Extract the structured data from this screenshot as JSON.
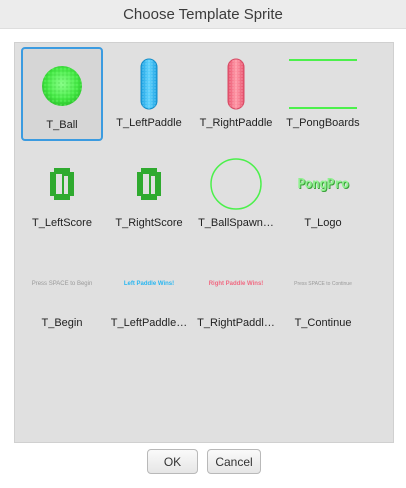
{
  "dialog": {
    "title": "Choose Template Sprite"
  },
  "sprites": [
    {
      "label": "T_Ball",
      "icon": "ball-icon",
      "selected": true
    },
    {
      "label": "T_LeftPaddle",
      "icon": "blue-paddle-icon"
    },
    {
      "label": "T_RightPaddle",
      "icon": "red-paddle-icon"
    },
    {
      "label": "T_PongBoards",
      "icon": "boards-icon"
    },
    {
      "label": "T_LeftScore",
      "icon": "score-digit-icon",
      "digit": "0"
    },
    {
      "label": "T_RightScore",
      "icon": "score-digit-icon",
      "digit": "0"
    },
    {
      "label": "T_BallSpawn…",
      "icon": "spawn-circle-icon"
    },
    {
      "label": "T_Logo",
      "icon": "logo-icon",
      "text": "PongPro"
    },
    {
      "label": "T_Begin",
      "icon": "begin-text-icon",
      "text": "Press SPACE to Begin"
    },
    {
      "label": "T_LeftPaddle…",
      "icon": "left-win-text-icon",
      "text": "Left Paddle Wins!"
    },
    {
      "label": "T_RightPaddl…",
      "icon": "right-win-text-icon",
      "text": "Right Paddle Wins!"
    },
    {
      "label": "T_Continue",
      "icon": "continue-text-icon",
      "text": "Press SPACE to Continue"
    }
  ],
  "buttons": {
    "ok": "OK",
    "cancel": "Cancel"
  },
  "colors": {
    "accent": "#3b9be0",
    "ball_green": "#4cf04c",
    "paddle_blue": "#29b6f0",
    "paddle_red": "#f06a82",
    "score_green": "#2faa2f"
  }
}
